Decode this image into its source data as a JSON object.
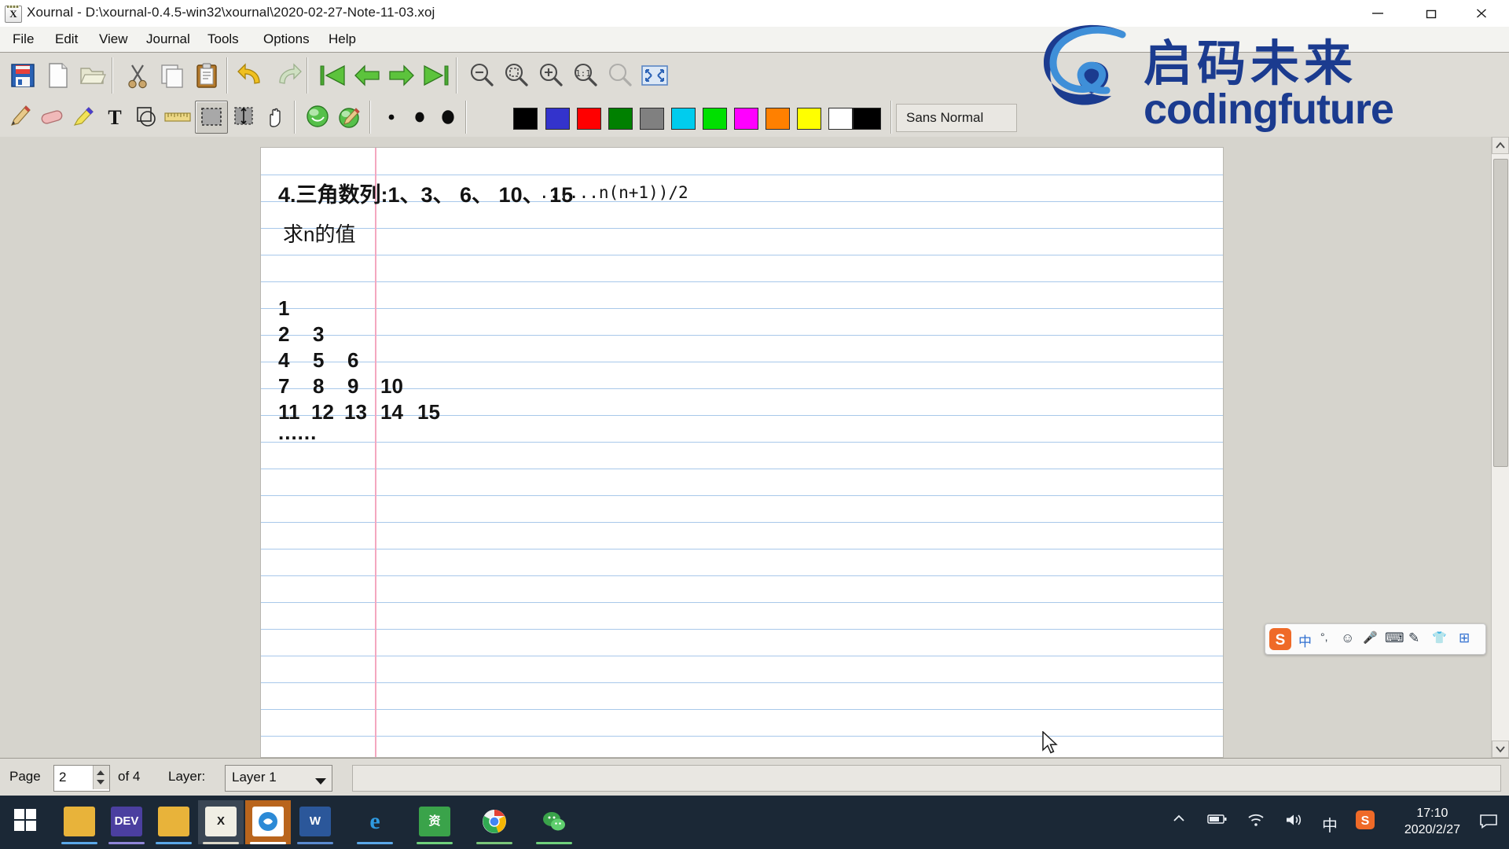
{
  "window": {
    "app_icon": "xournal-icon",
    "title": "Xournal - D:\\xournal-0.4.5-win32\\xournal\\2020-02-27-Note-11-03.xoj",
    "controls": {
      "minimize": "minimize-icon",
      "maximize": "maximize-icon",
      "close": "close-icon"
    }
  },
  "menubar": {
    "items": [
      {
        "label": "File"
      },
      {
        "label": "Edit"
      },
      {
        "label": "View"
      },
      {
        "label": "Journal"
      },
      {
        "label": "Tools"
      },
      {
        "label": "Options"
      },
      {
        "label": "Help"
      }
    ]
  },
  "toolbar_main": {
    "items": [
      {
        "name": "save-button",
        "icon": "floppy-save-icon"
      },
      {
        "name": "new-button",
        "icon": "new-page-icon"
      },
      {
        "name": "open-button",
        "icon": "open-folder-icon"
      },
      {
        "name": "cut-button",
        "icon": "scissors-cut-icon"
      },
      {
        "name": "copy-button",
        "icon": "copy-pages-icon"
      },
      {
        "name": "paste-button",
        "icon": "clipboard-paste-icon"
      },
      {
        "name": "undo-button",
        "icon": "undo-arrow-icon"
      },
      {
        "name": "redo-button",
        "icon": "redo-arrow-icon"
      },
      {
        "name": "first-page-button",
        "icon": "first-page-arrow-icon"
      },
      {
        "name": "previous-page-button",
        "icon": "previous-page-arrow-icon"
      },
      {
        "name": "next-page-button",
        "icon": "next-page-arrow-icon"
      },
      {
        "name": "last-page-button",
        "icon": "last-page-arrow-icon"
      },
      {
        "name": "zoom-out-button",
        "icon": "magnifier-minus-icon"
      },
      {
        "name": "zoom-fit-button",
        "icon": "magnifier-fit-icon"
      },
      {
        "name": "zoom-in-button",
        "icon": "magnifier-plus-icon"
      },
      {
        "name": "zoom-100-button",
        "icon": "magnifier-one-to-one-icon"
      },
      {
        "name": "zoom-select-button",
        "icon": "magnifier-disabled-icon"
      },
      {
        "name": "fullscreen-button",
        "icon": "fullscreen-icon"
      }
    ]
  },
  "toolbar_tools": {
    "items": [
      {
        "name": "pen-tool",
        "icon": "pencil-icon"
      },
      {
        "name": "eraser-tool",
        "icon": "eraser-icon"
      },
      {
        "name": "highlighter-tool",
        "icon": "highlighter-icon"
      },
      {
        "name": "text-tool",
        "icon": "text-t-icon"
      },
      {
        "name": "shape-tool",
        "icon": "shape-recognizer-icon"
      },
      {
        "name": "ruler-tool",
        "icon": "ruler-icon"
      },
      {
        "name": "select-rectangle-tool",
        "icon": "select-rectangle-icon"
      },
      {
        "name": "vertical-space-tool",
        "icon": "vertical-space-icon"
      },
      {
        "name": "hand-tool",
        "icon": "hand-icon"
      },
      {
        "name": "default-pen-button",
        "icon": "green-sphere-icon"
      },
      {
        "name": "default-tool-button",
        "icon": "green-sphere-pen-icon"
      }
    ],
    "thickness": [
      {
        "name": "thin-width",
        "icon": "dot-thin-icon"
      },
      {
        "name": "medium-width",
        "icon": "dot-medium-icon"
      },
      {
        "name": "thick-width",
        "icon": "dot-thick-icon"
      }
    ],
    "colors": [
      {
        "name": "color-black",
        "hex": "#000000"
      },
      {
        "name": "color-blue",
        "hex": "#3333cc"
      },
      {
        "name": "color-red",
        "hex": "#ff0000"
      },
      {
        "name": "color-green",
        "hex": "#008000"
      },
      {
        "name": "color-gray",
        "hex": "#808080"
      },
      {
        "name": "color-cyan",
        "hex": "#00ccee"
      },
      {
        "name": "color-lightgreen",
        "hex": "#00e000"
      },
      {
        "name": "color-magenta",
        "hex": "#ff00ff"
      },
      {
        "name": "color-orange",
        "hex": "#ff8000"
      },
      {
        "name": "color-yellow",
        "hex": "#ffff00"
      },
      {
        "name": "color-white",
        "hex": "#ffffff"
      },
      {
        "name": "color-black2",
        "hex": "#000000"
      }
    ],
    "font": {
      "label": "Sans Normal"
    }
  },
  "document": {
    "page_background": "ruled",
    "ink": {
      "heading": "4.三角数列:1、3、 6、 10、 15",
      "heading_formula": "......n(n+1))/2",
      "question": "求n的值",
      "pyramid": [
        [
          "1"
        ],
        [
          "2",
          "3"
        ],
        [
          "4",
          "5",
          "6"
        ],
        [
          "7",
          "8",
          "9",
          "10"
        ],
        [
          "11",
          "12",
          "13",
          "14",
          "15"
        ]
      ],
      "ellipsis": "......"
    }
  },
  "statusbar": {
    "page_label": "Page",
    "page_value": "2",
    "page_of": "of 4",
    "layer_label": "Layer:",
    "layer_value": "Layer 1",
    "layer_caret": "chevron-down-icon"
  },
  "taskbar": {
    "start": "windows-start-icon",
    "apps": [
      {
        "name": "file-explorer",
        "glyph": "",
        "color": "#e8b33a",
        "under": "#5ba8e8",
        "state": "open"
      },
      {
        "name": "dev-cpp",
        "glyph": "DEV",
        "color": "#4b3fa0",
        "under": "#8f86d8",
        "state": "open"
      },
      {
        "name": "folder-window",
        "glyph": "",
        "color": "#e8b33a",
        "under": "#5ba8e8",
        "state": "open"
      },
      {
        "name": "xournal",
        "glyph": "X",
        "color": "#f0eee4",
        "under": "#d9d6c8",
        "state": "active"
      },
      {
        "name": "wechat-dev",
        "glyph": "",
        "color": "#ffffff",
        "under": "#ffffff",
        "state": "running"
      },
      {
        "name": "word",
        "glyph": "W",
        "color": "#2b579a",
        "under": "#5b8bd0",
        "state": "open"
      },
      {
        "name": "internet-explorer",
        "glyph": "e",
        "color": "#1a7cc6",
        "under": "#5ba8e8",
        "state": "open"
      },
      {
        "name": "resource-app",
        "glyph": "资",
        "color": "#3aa34a",
        "under": "#6fd07c",
        "state": "open"
      },
      {
        "name": "chrome",
        "glyph": "",
        "color": "#f4f4f4",
        "under": "#7ac67a",
        "state": "open"
      },
      {
        "name": "wechat",
        "glyph": "",
        "color": "#3aa34a",
        "under": "#6fd07c",
        "state": "open"
      }
    ],
    "tray": [
      {
        "name": "show-hidden-icons",
        "icon": "chevron-up-icon"
      },
      {
        "name": "battery-icon",
        "icon": "battery-icon"
      },
      {
        "name": "wifi-icon",
        "icon": "wifi-icon"
      },
      {
        "name": "volume-icon",
        "icon": "speaker-icon"
      },
      {
        "name": "ime-mode",
        "icon": "chinese-mode-icon",
        "label": "中"
      },
      {
        "name": "sogou-tray",
        "icon": "sogou-icon",
        "label": "S"
      }
    ],
    "clock": {
      "time": "17:10",
      "date": "2020/2/27"
    },
    "action_center": "notification-icon"
  },
  "overlay_logo": {
    "cn": "启码未来",
    "en": "codingfuture",
    "mark": "e-swoosh-logo-icon",
    "color": "#1b3b8f"
  },
  "ime_bar": {
    "logo": "sogou-s-icon",
    "items": [
      {
        "name": "ime-lang-toggle",
        "label": "中"
      },
      {
        "name": "ime-punct-toggle",
        "label": "°,"
      },
      {
        "name": "ime-emoji",
        "label": "☺"
      },
      {
        "name": "ime-voice",
        "label": "🎤"
      },
      {
        "name": "ime-keyboard",
        "label": "⌨"
      },
      {
        "name": "ime-handwriting",
        "label": "✎"
      },
      {
        "name": "ime-skin",
        "label": "👕"
      },
      {
        "name": "ime-toolbox",
        "label": "⊞"
      }
    ]
  }
}
